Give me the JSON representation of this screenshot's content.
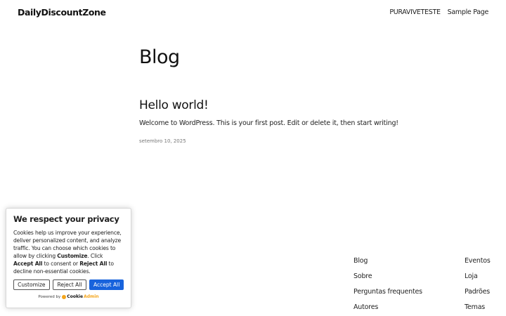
{
  "header": {
    "site_title": "DailyDiscountZone",
    "nav": [
      "PURAVIVETESTE",
      "Sample Page"
    ]
  },
  "main": {
    "heading": "Blog",
    "post": {
      "title": "Hello world!",
      "excerpt": "Welcome to WordPress. This is your first post. Edit or delete it, then start writing!",
      "date": "setembro 10, 2025"
    }
  },
  "footer": {
    "col1": [
      "Blog",
      "Sobre",
      "Perguntas frequentes",
      "Autores"
    ],
    "col2": [
      "Eventos",
      "Loja",
      "Padrões",
      "Temas"
    ]
  },
  "cookie": {
    "title": "We respect your privacy",
    "text_1": "Cookies help us improve your experience, deliver personalized content, and analyze traffic. You can choose which cookies to allow by clicking ",
    "customize_word": "Customize",
    "text_2": ". Click ",
    "accept_word": "Accept All",
    "text_3": " to consent or ",
    "reject_word": "Reject All",
    "text_4": " to decline non-essential cookies.",
    "btn_customize": "Customize",
    "btn_reject": "Reject All",
    "btn_accept": "Accept All",
    "powered_by": "Powered by",
    "brand_part1": "Cookie",
    "brand_part2": "Admin",
    "accent_color": "#1863dc"
  }
}
